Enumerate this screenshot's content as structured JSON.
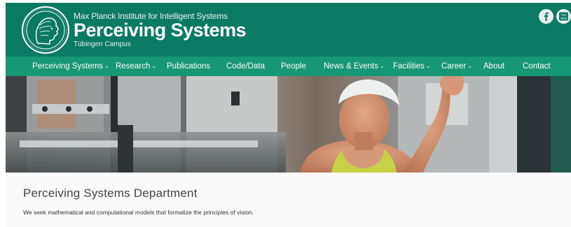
{
  "header": {
    "institute": "Max Planck Institute for Intelligent Systems",
    "department": "Perceiving Systems",
    "campus": "Tübingen Campus",
    "logo_icon": "minerva-seal-icon",
    "social": [
      {
        "name": "facebook-icon"
      },
      {
        "name": "youtube-icon",
        "label": "You Tube"
      }
    ]
  },
  "nav": {
    "items": [
      {
        "label": "Perceiving Systems",
        "has_dropdown": true
      },
      {
        "label": "Research",
        "has_dropdown": true
      },
      {
        "label": "Publications",
        "has_dropdown": false
      },
      {
        "label": "Code/Data",
        "has_dropdown": false
      },
      {
        "label": "People",
        "has_dropdown": false
      },
      {
        "label": "News & Events",
        "has_dropdown": true
      },
      {
        "label": "Facilities",
        "has_dropdown": true
      },
      {
        "label": "Career",
        "has_dropdown": true
      },
      {
        "label": "About",
        "has_dropdown": false
      },
      {
        "label": "Contact",
        "has_dropdown": false
      }
    ],
    "caret": "⌄"
  },
  "main": {
    "title": "Perceiving Systems Department",
    "description": "We seek mathematical and computational models that formalize the principles of vision."
  },
  "colors": {
    "header_bg": "#0b7a63",
    "nav_bg": "#179773",
    "page_bg": "#fafafa"
  }
}
